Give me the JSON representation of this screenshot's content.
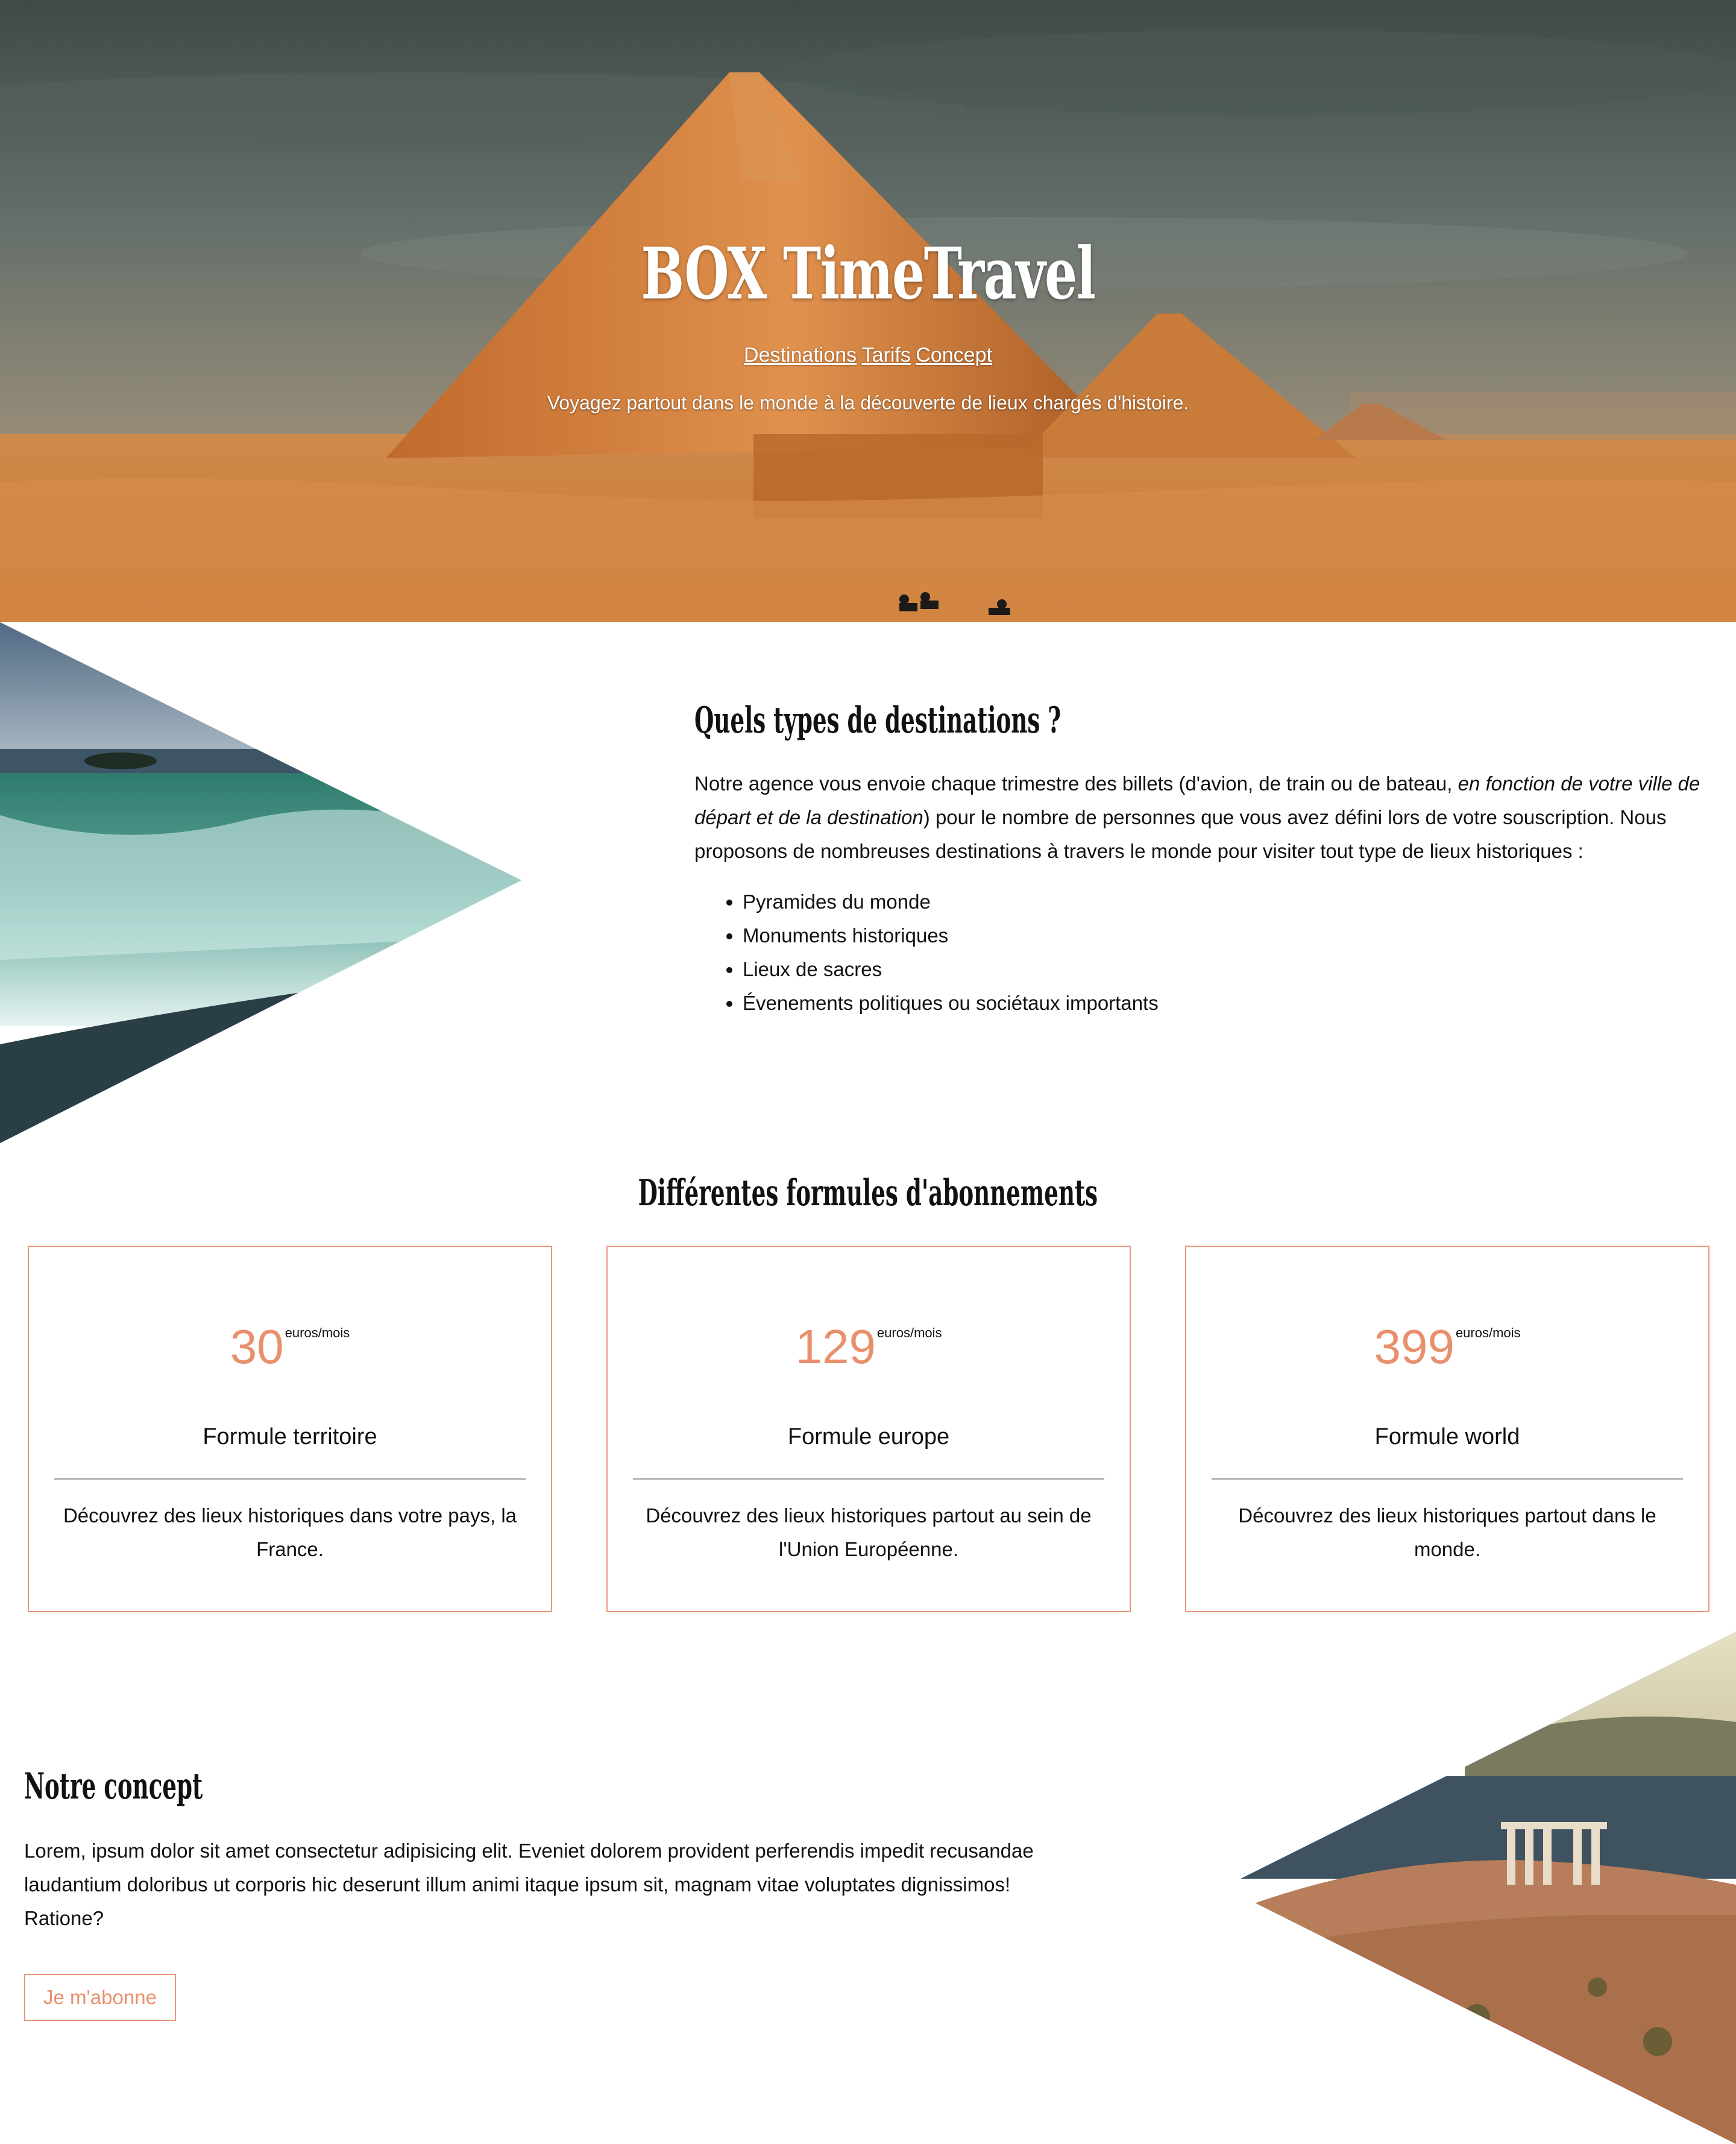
{
  "hero": {
    "title": "BOX TimeTravel",
    "nav": [
      {
        "label": "Destinations"
      },
      {
        "label": "Tarifs"
      },
      {
        "label": "Concept"
      }
    ],
    "tagline": "Voyagez partout dans le monde à la découverte de lieux chargés d'histoire."
  },
  "destinations": {
    "title": "Quels types de destinations ?",
    "intro_before": "Notre agence vous envoie chaque trimestre des billets (d'avion, de train ou de bateau, ",
    "intro_em": "en fonction de votre ville de départ et de la destination",
    "intro_after": ") pour le nombre de personnes que vous avez défini lors de votre souscription. Nous proposons de nombreuses destinations à travers le monde pour visiter tout type de lieux historiques :",
    "items": [
      "Pyramides du monde",
      "Monuments historiques",
      "Lieux de sacres",
      "Évenements politiques ou sociétaux importants"
    ]
  },
  "pricing": {
    "title": "Différentes formules d'abonnements",
    "plans": [
      {
        "amount": "30",
        "unit": "euros/mois",
        "name": "Formule territoire",
        "description": "Découvrez des lieux historiques dans votre pays, la France."
      },
      {
        "amount": "129",
        "unit": "euros/mois",
        "name": "Formule europe",
        "description": "Découvrez des lieux historiques partout au sein de l'Union Européenne."
      },
      {
        "amount": "399",
        "unit": "euros/mois",
        "name": "Formule world",
        "description": "Découvrez des lieux historiques partout dans le monde."
      }
    ]
  },
  "concept": {
    "title": "Notre concept",
    "text": "Lorem, ipsum dolor sit amet consectetur adipisicing elit. Eveniet dolorem provident perferendis impedit recusandae laudantium doloribus ut corporis hic deserunt illum animi itaque ipsum sit, magnam vitae voluptates dignissimos! Ratione?",
    "button_label": "Je m'abonne"
  },
  "colors": {
    "accent": "#e8906d",
    "border": "#e9977a",
    "text": "#111111"
  },
  "images": {
    "hero": "pyramids-desert-photo",
    "destinations": "waterfall-photo",
    "concept": "greek-temple-coast-photo"
  }
}
